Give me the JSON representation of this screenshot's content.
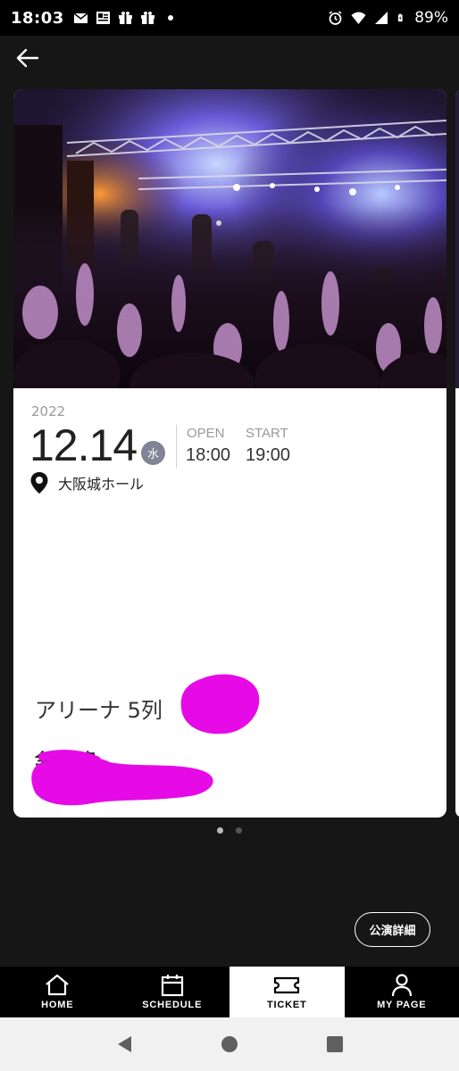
{
  "status_bar": {
    "time": "18:03",
    "battery_percent": "89%",
    "left_icons": [
      "mail-icon",
      "news-icon",
      "gift-icon",
      "gift-icon",
      "notification-dot"
    ],
    "right_icons": [
      "alarm-icon",
      "wifi-icon",
      "signal-icon",
      "battery-icon"
    ]
  },
  "header": {
    "back_icon": "arrow-left-icon"
  },
  "ticket": {
    "year": "2022",
    "date": "12.14",
    "weekday": "水",
    "open_label": "OPEN",
    "open_time": "18:00",
    "start_label": "START",
    "start_time": "19:00",
    "venue": "大阪城ホール",
    "seat": "アリーナ 5列",
    "seat_type": "全席指定"
  },
  "carousel": {
    "pages": 2,
    "active_index": 0
  },
  "details_button": {
    "label": "公演詳細"
  },
  "bottom_nav": {
    "items": [
      {
        "label": "HOME",
        "icon": "home-icon"
      },
      {
        "label": "SCHEDULE",
        "icon": "calendar-icon"
      },
      {
        "label": "TICKET",
        "icon": "ticket-icon"
      },
      {
        "label": "MY PAGE",
        "icon": "person-icon"
      }
    ],
    "active_index": 2
  },
  "system_nav": {
    "buttons": [
      "back-triangle-icon",
      "home-circle-icon",
      "recents-square-icon"
    ]
  },
  "colors": {
    "background": "#161616",
    "card": "#ffffff",
    "weekday_badge": "#7f8597",
    "scribble": "#e60ae6",
    "nav_active": "#ffffff"
  }
}
